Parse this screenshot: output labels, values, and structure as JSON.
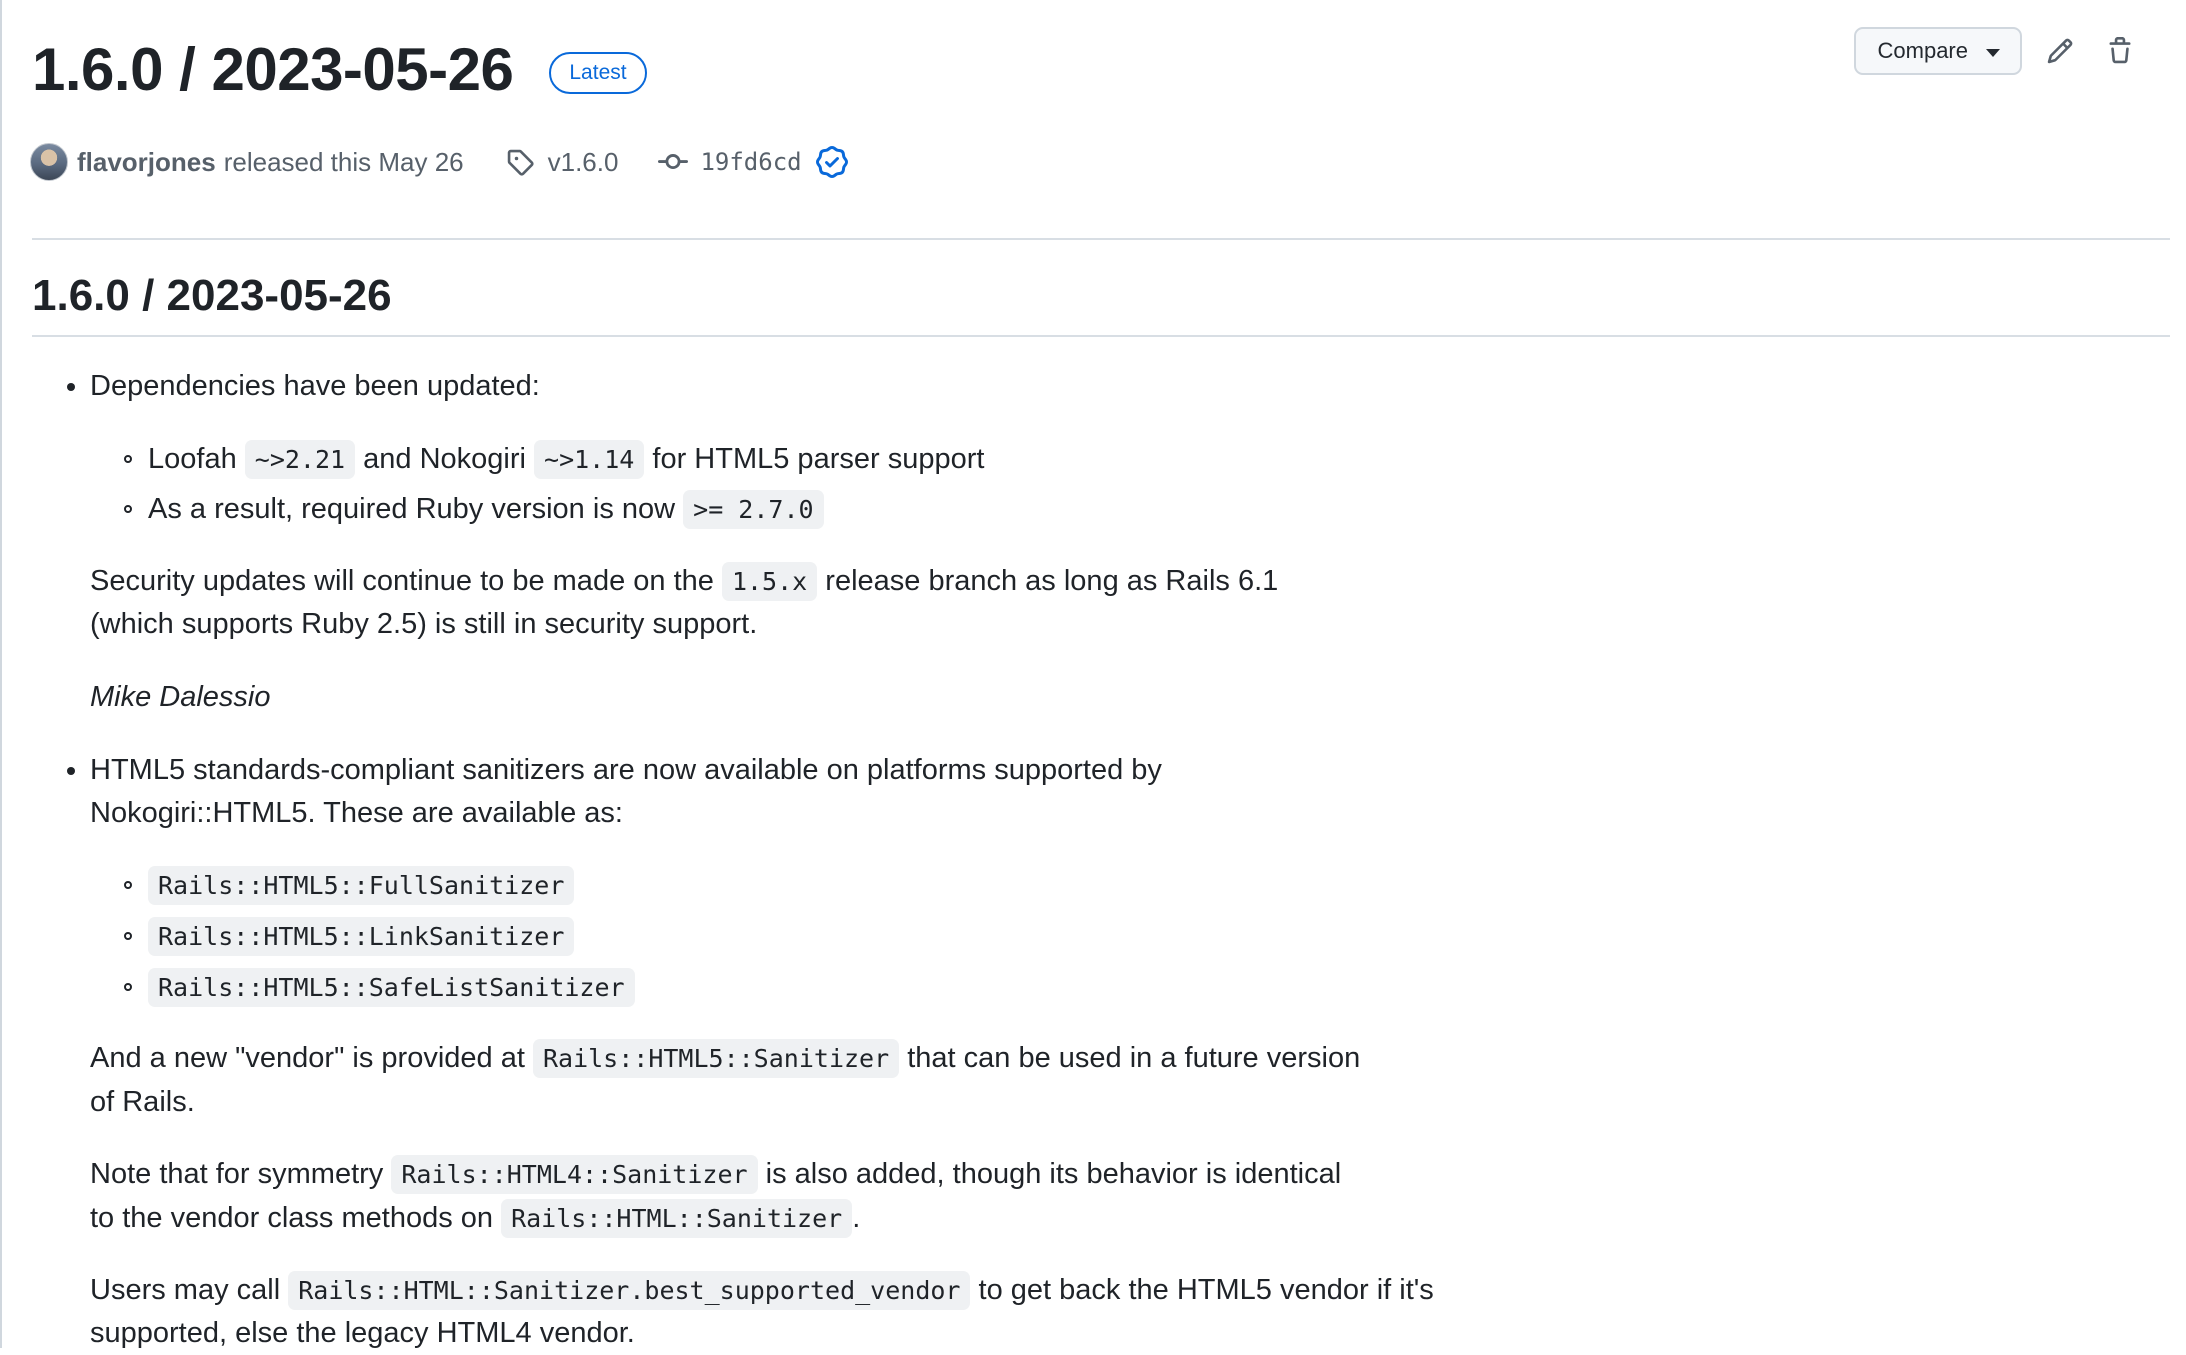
{
  "release": {
    "title": "1.6.0 / 2023-05-26",
    "badge": "Latest",
    "author": "flavorjones",
    "released_text": "released this May 26",
    "tag": "v1.6.0",
    "commit": "19fd6cd"
  },
  "actions": {
    "compare_label": "Compare"
  },
  "icons": {
    "tag": "tag-icon",
    "commit": "git-commit-icon",
    "verified": "verified-check-icon",
    "edit": "pencil-icon",
    "delete": "trash-icon",
    "caret": "caret-down-icon"
  },
  "colors": {
    "accent": "#0969da",
    "text": "#1f2328",
    "muted": "#57606a"
  },
  "body": {
    "heading": "1.6.0 / 2023-05-26",
    "deps_intro": "Dependencies have been updated:",
    "dep1": {
      "pre": "Loofah",
      "code1": "~>2.21",
      "mid": "and Nokogiri",
      "code2": "~>1.14",
      "post": "for HTML5 parser support"
    },
    "dep2": {
      "pre": "As a result, required Ruby version is now",
      "code": ">= 2.7.0"
    },
    "security": {
      "pre": "Security updates will continue to be made on the",
      "code": "1.5.x",
      "post": "release branch as long as Rails 6.1",
      "line2": "(which supports Ruby 2.5) is still in security support."
    },
    "author_sig": "Mike Dalessio",
    "html5_intro": {
      "line1": "HTML5 standards-compliant sanitizers are now available on platforms supported by",
      "line2": "Nokogiri::HTML5. These are available as:"
    },
    "sanitizers": [
      "Rails::HTML5::FullSanitizer",
      "Rails::HTML5::LinkSanitizer",
      "Rails::HTML5::SafeListSanitizer"
    ],
    "vendor": {
      "pre": "And a new \"vendor\" is provided at",
      "code": "Rails::HTML5::Sanitizer",
      "post": "that can be used in a future version",
      "line2": "of Rails."
    },
    "symmetry": {
      "pre": "Note that for symmetry",
      "code": "Rails::HTML4::Sanitizer",
      "post": "is also added, though its behavior is identical",
      "line2_pre": "to the vendor class methods on",
      "line2_code": "Rails::HTML::Sanitizer",
      "line2_post": "."
    },
    "users": {
      "pre": "Users may call",
      "code": "Rails::HTML::Sanitizer.best_supported_vendor",
      "post": "to get back the HTML5 vendor if it's",
      "line2": "supported, else the legacy HTML4 vendor."
    }
  }
}
